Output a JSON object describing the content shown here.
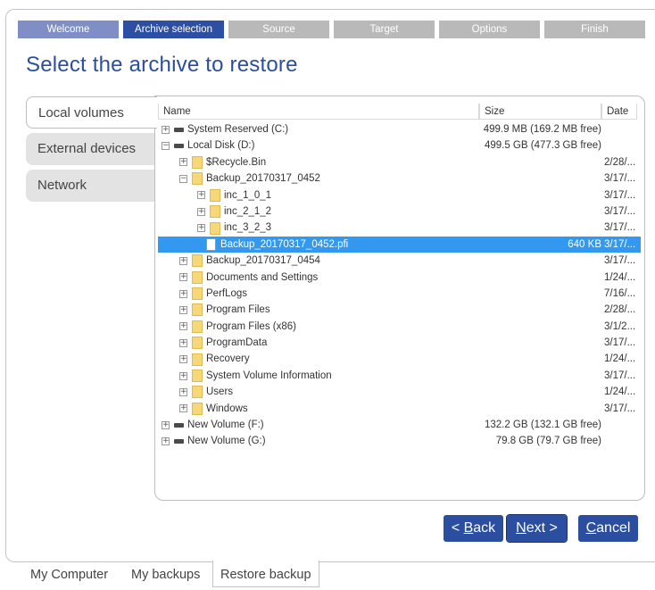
{
  "wizard_steps": [
    {
      "label": "Welcome",
      "state": "done"
    },
    {
      "label": "Archive selection",
      "state": "active"
    },
    {
      "label": "Source",
      "state": "pending"
    },
    {
      "label": "Target",
      "state": "pending"
    },
    {
      "label": "Options",
      "state": "pending"
    },
    {
      "label": "Finish",
      "state": "pending"
    }
  ],
  "title": "Select the archive to restore",
  "side_tabs": [
    "Local volumes",
    "External devices",
    "Network"
  ],
  "columns": {
    "name": "Name",
    "size": "Size",
    "date": "Date"
  },
  "rows": [
    {
      "expander": "+",
      "icon": "drive-icon",
      "name": "System Reserved (C:)",
      "size": "499.9 MB (169.2 MB free)",
      "date": ""
    },
    {
      "expander": "-",
      "icon": "drive-icon",
      "name": "Local Disk (D:)",
      "size": "499.5 GB (477.3 GB free)",
      "date": ""
    },
    {
      "expander": "+",
      "icon": "folder-icon",
      "name": "$Recycle.Bin",
      "size": "",
      "date": "2/28/..."
    },
    {
      "expander": "-",
      "icon": "folder-icon",
      "name": "Backup_20170317_0452",
      "size": "",
      "date": "3/17/..."
    },
    {
      "expander": "+",
      "icon": "folder-icon",
      "name": "inc_1_0_1",
      "size": "",
      "date": "3/17/..."
    },
    {
      "expander": "+",
      "icon": "folder-icon",
      "name": "inc_2_1_2",
      "size": "",
      "date": "3/17/..."
    },
    {
      "expander": "+",
      "icon": "folder-icon",
      "name": "inc_3_2_3",
      "size": "",
      "date": "3/17/..."
    },
    {
      "expander": "",
      "icon": "file-icon",
      "name": "Backup_20170317_0452.pfi",
      "size": "640 KB",
      "date": "3/17/..."
    },
    {
      "expander": "+",
      "icon": "folder-icon",
      "name": "Backup_20170317_0454",
      "size": "",
      "date": "3/17/..."
    },
    {
      "expander": "+",
      "icon": "folder-icon",
      "name": "Documents and Settings",
      "size": "",
      "date": "1/24/..."
    },
    {
      "expander": "+",
      "icon": "folder-icon",
      "name": "PerfLogs",
      "size": "",
      "date": "7/16/..."
    },
    {
      "expander": "+",
      "icon": "folder-icon",
      "name": "Program Files",
      "size": "",
      "date": "2/28/..."
    },
    {
      "expander": "+",
      "icon": "folder-icon",
      "name": "Program Files (x86)",
      "size": "",
      "date": "3/1/2..."
    },
    {
      "expander": "+",
      "icon": "folder-icon",
      "name": "ProgramData",
      "size": "",
      "date": "3/17/..."
    },
    {
      "expander": "+",
      "icon": "folder-icon",
      "name": "Recovery",
      "size": "",
      "date": "1/24/..."
    },
    {
      "expander": "+",
      "icon": "folder-icon",
      "name": "System Volume Information",
      "size": "",
      "date": "3/17/..."
    },
    {
      "expander": "+",
      "icon": "folder-icon",
      "name": "Users",
      "size": "",
      "date": "1/24/..."
    },
    {
      "expander": "+",
      "icon": "folder-icon",
      "name": "Windows",
      "size": "",
      "date": "3/17/..."
    },
    {
      "expander": "+",
      "icon": "drive-icon",
      "name": "New Volume (F:)",
      "size": "132.2 GB (132.1 GB free)",
      "date": ""
    },
    {
      "expander": "+",
      "icon": "drive-icon",
      "name": "New Volume (G:)",
      "size": "79.8 GB (79.7 GB free)",
      "date": ""
    }
  ],
  "selected_row": "Backup_20170317_0452.pfi",
  "buttons": {
    "back": {
      "prefix": "< ",
      "key": "B",
      "rest": "ack"
    },
    "next": {
      "prefix": "",
      "key": "N",
      "rest": "ext >"
    },
    "cancel": {
      "prefix": "",
      "key": "C",
      "rest": "ancel"
    }
  },
  "bottom_tabs": [
    "My Computer",
    "My backups",
    "Restore backup"
  ],
  "colors": {
    "accent": "#2c4fa4",
    "selection": "#3399f0",
    "step_done": "#7f8fc6",
    "step_pending": "#b9b9b9"
  }
}
